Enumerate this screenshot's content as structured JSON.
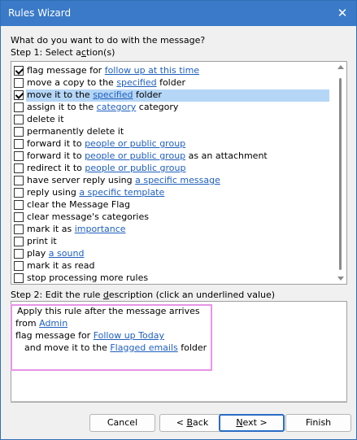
{
  "window": {
    "title": "Rules Wizard",
    "close_glyph": "✕"
  },
  "prompt": "What do you want to do with the message?",
  "step1": {
    "prefix": "Step 1: Select a",
    "underlined": "c",
    "suffix": "tion(s)"
  },
  "actions": [
    {
      "checked": true,
      "selected": false,
      "parts": [
        "flag message for ",
        "follow up at this time",
        ""
      ]
    },
    {
      "checked": false,
      "selected": false,
      "parts": [
        "move a copy to the ",
        "specified",
        " folder"
      ]
    },
    {
      "checked": true,
      "selected": true,
      "parts": [
        "move it to the ",
        "specified",
        " folder"
      ]
    },
    {
      "checked": false,
      "selected": false,
      "parts": [
        "assign it to the ",
        "category",
        " category"
      ]
    },
    {
      "checked": false,
      "selected": false,
      "parts": [
        "delete it",
        "",
        ""
      ]
    },
    {
      "checked": false,
      "selected": false,
      "parts": [
        "permanently delete it",
        "",
        ""
      ]
    },
    {
      "checked": false,
      "selected": false,
      "parts": [
        "forward it to ",
        "people or public group",
        ""
      ]
    },
    {
      "checked": false,
      "selected": false,
      "parts": [
        "forward it to ",
        "people or public group",
        " as an attachment"
      ]
    },
    {
      "checked": false,
      "selected": false,
      "parts": [
        "redirect it to ",
        "people or public group",
        ""
      ]
    },
    {
      "checked": false,
      "selected": false,
      "parts": [
        "have server reply using ",
        "a specific message",
        ""
      ]
    },
    {
      "checked": false,
      "selected": false,
      "parts": [
        "reply using ",
        "a specific template",
        ""
      ]
    },
    {
      "checked": false,
      "selected": false,
      "parts": [
        "clear the Message Flag",
        "",
        ""
      ]
    },
    {
      "checked": false,
      "selected": false,
      "parts": [
        "clear message's categories",
        "",
        ""
      ]
    },
    {
      "checked": false,
      "selected": false,
      "parts": [
        "mark it as ",
        "importance",
        ""
      ]
    },
    {
      "checked": false,
      "selected": false,
      "parts": [
        "print it",
        "",
        ""
      ]
    },
    {
      "checked": false,
      "selected": false,
      "parts": [
        "play ",
        "a sound",
        ""
      ]
    },
    {
      "checked": false,
      "selected": false,
      "parts": [
        "mark it as read",
        "",
        ""
      ]
    },
    {
      "checked": false,
      "selected": false,
      "parts": [
        "stop processing more rules",
        "",
        ""
      ]
    }
  ],
  "step2": {
    "prefix": "Step 2: Edit the rule ",
    "underlined": "d",
    "suffix": "escription (click an underlined value)"
  },
  "description": {
    "line1": "Apply this rule after the message arrives",
    "line2_prefix": "from ",
    "line2_link": "Admin",
    "line3_prefix": "flag message for ",
    "line3_link": "Follow up Today",
    "line4_prefix": "  and move it to the ",
    "line4_link": "Flagged emails",
    "line4_suffix": " folder"
  },
  "buttons": {
    "cancel": "Cancel",
    "back_prefix": "< ",
    "back_underlined": "B",
    "back_suffix": "ack",
    "next_underlined": "N",
    "next_suffix": "ext >",
    "finish": "Finish"
  },
  "colors": {
    "titlebar": "#3a7ac8",
    "link": "#1f5fbf",
    "selection": "#b5d6f7",
    "highlight_border": "#e695e6"
  }
}
